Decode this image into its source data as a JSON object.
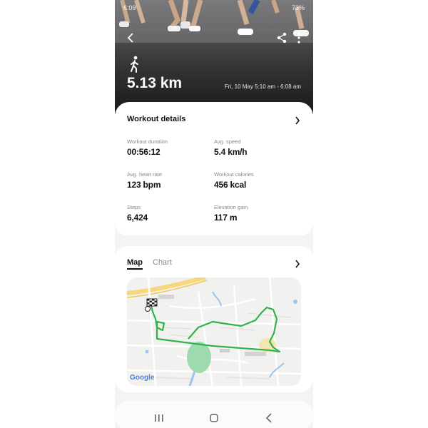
{
  "status_bar": {
    "time": "6:09",
    "battery": "73%"
  },
  "header": {
    "distance": "5.13 km",
    "date_range": "Fri, 10 May 5:10 am - 6:08 am"
  },
  "details": {
    "title": "Workout details",
    "stats": [
      {
        "label": "Workout duration",
        "value": "00:56:12"
      },
      {
        "label": "Avg. speed",
        "value": "5.4 km/h"
      },
      {
        "label": "Avg. heart rate",
        "value": "123 bpm"
      },
      {
        "label": "Workout calories",
        "value": "456 kcal"
      },
      {
        "label": "Steps",
        "value": "6,424"
      },
      {
        "label": "Elevation gain",
        "value": "117 m"
      }
    ]
  },
  "map_card": {
    "tabs": [
      "Map",
      "Chart"
    ],
    "active_tab": "Map",
    "map_attribution": "Google",
    "route_color": "#2fb34a"
  },
  "icons": {
    "back": "chevron-left-icon",
    "share": "share-icon",
    "more": "more-vert-icon",
    "activity": "walking-icon",
    "finish": "checkered-flag-icon"
  }
}
